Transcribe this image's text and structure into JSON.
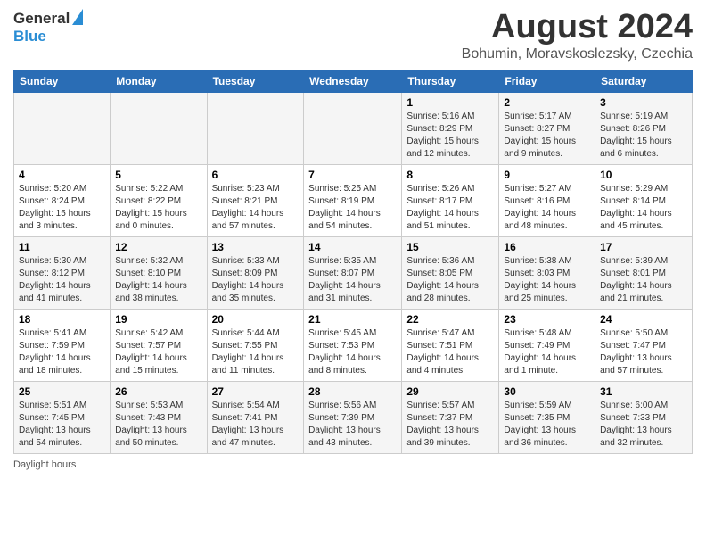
{
  "header": {
    "logo_general": "General",
    "logo_blue": "Blue",
    "main_title": "August 2024",
    "subtitle": "Bohumin, Moravskoslezsky, Czechia"
  },
  "calendar": {
    "days_of_week": [
      "Sunday",
      "Monday",
      "Tuesday",
      "Wednesday",
      "Thursday",
      "Friday",
      "Saturday"
    ],
    "weeks": [
      [
        {
          "day": "",
          "info": ""
        },
        {
          "day": "",
          "info": ""
        },
        {
          "day": "",
          "info": ""
        },
        {
          "day": "",
          "info": ""
        },
        {
          "day": "1",
          "info": "Sunrise: 5:16 AM\nSunset: 8:29 PM\nDaylight: 15 hours and 12 minutes."
        },
        {
          "day": "2",
          "info": "Sunrise: 5:17 AM\nSunset: 8:27 PM\nDaylight: 15 hours and 9 minutes."
        },
        {
          "day": "3",
          "info": "Sunrise: 5:19 AM\nSunset: 8:26 PM\nDaylight: 15 hours and 6 minutes."
        }
      ],
      [
        {
          "day": "4",
          "info": "Sunrise: 5:20 AM\nSunset: 8:24 PM\nDaylight: 15 hours and 3 minutes."
        },
        {
          "day": "5",
          "info": "Sunrise: 5:22 AM\nSunset: 8:22 PM\nDaylight: 15 hours and 0 minutes."
        },
        {
          "day": "6",
          "info": "Sunrise: 5:23 AM\nSunset: 8:21 PM\nDaylight: 14 hours and 57 minutes."
        },
        {
          "day": "7",
          "info": "Sunrise: 5:25 AM\nSunset: 8:19 PM\nDaylight: 14 hours and 54 minutes."
        },
        {
          "day": "8",
          "info": "Sunrise: 5:26 AM\nSunset: 8:17 PM\nDaylight: 14 hours and 51 minutes."
        },
        {
          "day": "9",
          "info": "Sunrise: 5:27 AM\nSunset: 8:16 PM\nDaylight: 14 hours and 48 minutes."
        },
        {
          "day": "10",
          "info": "Sunrise: 5:29 AM\nSunset: 8:14 PM\nDaylight: 14 hours and 45 minutes."
        }
      ],
      [
        {
          "day": "11",
          "info": "Sunrise: 5:30 AM\nSunset: 8:12 PM\nDaylight: 14 hours and 41 minutes."
        },
        {
          "day": "12",
          "info": "Sunrise: 5:32 AM\nSunset: 8:10 PM\nDaylight: 14 hours and 38 minutes."
        },
        {
          "day": "13",
          "info": "Sunrise: 5:33 AM\nSunset: 8:09 PM\nDaylight: 14 hours and 35 minutes."
        },
        {
          "day": "14",
          "info": "Sunrise: 5:35 AM\nSunset: 8:07 PM\nDaylight: 14 hours and 31 minutes."
        },
        {
          "day": "15",
          "info": "Sunrise: 5:36 AM\nSunset: 8:05 PM\nDaylight: 14 hours and 28 minutes."
        },
        {
          "day": "16",
          "info": "Sunrise: 5:38 AM\nSunset: 8:03 PM\nDaylight: 14 hours and 25 minutes."
        },
        {
          "day": "17",
          "info": "Sunrise: 5:39 AM\nSunset: 8:01 PM\nDaylight: 14 hours and 21 minutes."
        }
      ],
      [
        {
          "day": "18",
          "info": "Sunrise: 5:41 AM\nSunset: 7:59 PM\nDaylight: 14 hours and 18 minutes."
        },
        {
          "day": "19",
          "info": "Sunrise: 5:42 AM\nSunset: 7:57 PM\nDaylight: 14 hours and 15 minutes."
        },
        {
          "day": "20",
          "info": "Sunrise: 5:44 AM\nSunset: 7:55 PM\nDaylight: 14 hours and 11 minutes."
        },
        {
          "day": "21",
          "info": "Sunrise: 5:45 AM\nSunset: 7:53 PM\nDaylight: 14 hours and 8 minutes."
        },
        {
          "day": "22",
          "info": "Sunrise: 5:47 AM\nSunset: 7:51 PM\nDaylight: 14 hours and 4 minutes."
        },
        {
          "day": "23",
          "info": "Sunrise: 5:48 AM\nSunset: 7:49 PM\nDaylight: 14 hours and 1 minute."
        },
        {
          "day": "24",
          "info": "Sunrise: 5:50 AM\nSunset: 7:47 PM\nDaylight: 13 hours and 57 minutes."
        }
      ],
      [
        {
          "day": "25",
          "info": "Sunrise: 5:51 AM\nSunset: 7:45 PM\nDaylight: 13 hours and 54 minutes."
        },
        {
          "day": "26",
          "info": "Sunrise: 5:53 AM\nSunset: 7:43 PM\nDaylight: 13 hours and 50 minutes."
        },
        {
          "day": "27",
          "info": "Sunrise: 5:54 AM\nSunset: 7:41 PM\nDaylight: 13 hours and 47 minutes."
        },
        {
          "day": "28",
          "info": "Sunrise: 5:56 AM\nSunset: 7:39 PM\nDaylight: 13 hours and 43 minutes."
        },
        {
          "day": "29",
          "info": "Sunrise: 5:57 AM\nSunset: 7:37 PM\nDaylight: 13 hours and 39 minutes."
        },
        {
          "day": "30",
          "info": "Sunrise: 5:59 AM\nSunset: 7:35 PM\nDaylight: 13 hours and 36 minutes."
        },
        {
          "day": "31",
          "info": "Sunrise: 6:00 AM\nSunset: 7:33 PM\nDaylight: 13 hours and 32 minutes."
        }
      ]
    ]
  },
  "footer": {
    "daylight_label": "Daylight hours"
  }
}
